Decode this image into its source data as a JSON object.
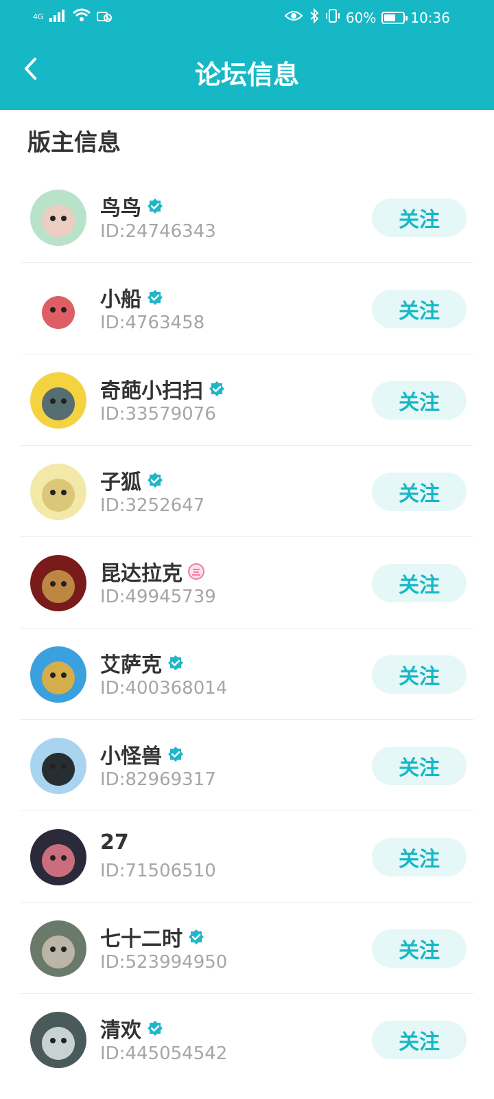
{
  "status_bar": {
    "network": "4G",
    "battery": "60%",
    "battery_level": 0.6,
    "time": "10:36"
  },
  "header": {
    "title": "论坛信息",
    "back_icon": "chevron-left-icon"
  },
  "section": {
    "title": "版主信息"
  },
  "follow_label": "关注",
  "moderators": [
    {
      "name": "鸟鸟",
      "id": "ID:24746343",
      "badge": "verified-icon",
      "colors": [
        "#b8e3c8",
        "#f4c9c0"
      ]
    },
    {
      "name": "小船",
      "id": "ID:4763458",
      "badge": "verified-icon",
      "colors": [
        "#ffffff",
        "#d9424a"
      ]
    },
    {
      "name": "奇葩小扫扫",
      "id": "ID:33579076",
      "badge": "verified-icon",
      "colors": [
        "#f5d340",
        "#3a5a7a"
      ]
    },
    {
      "name": "子狐",
      "id": "ID:3252647",
      "badge": "verified-icon",
      "colors": [
        "#f2e8a8",
        "#d8c070"
      ]
    },
    {
      "name": "昆达拉克",
      "id": "ID:49945739",
      "badge": "level-icon",
      "colors": [
        "#7a1b1b",
        "#c99a4a"
      ]
    },
    {
      "name": "艾萨克",
      "id": "ID:400368014",
      "badge": "verified-icon",
      "colors": [
        "#3aa0e0",
        "#f0b030"
      ]
    },
    {
      "name": "小怪兽",
      "id": "ID:82969317",
      "badge": "verified-icon",
      "colors": [
        "#a8d4f0",
        "#111111"
      ]
    },
    {
      "name": "27",
      "id": "ID:71506510",
      "badge": "",
      "colors": [
        "#2a2a3a",
        "#e67a8a"
      ]
    },
    {
      "name": "七十二时",
      "id": "ID:523994950",
      "badge": "verified-icon",
      "colors": [
        "#6a7a6a",
        "#c8c0b0"
      ]
    },
    {
      "name": "清欢",
      "id": "ID:445054542",
      "badge": "verified-icon",
      "colors": [
        "#4a5a5a",
        "#dfe8e8"
      ]
    }
  ],
  "colors": {
    "accent": "#16b8c6",
    "follow_bg": "#e6f7f8",
    "verified": "#1fb6c8",
    "level_badge": "#f07ca0"
  }
}
